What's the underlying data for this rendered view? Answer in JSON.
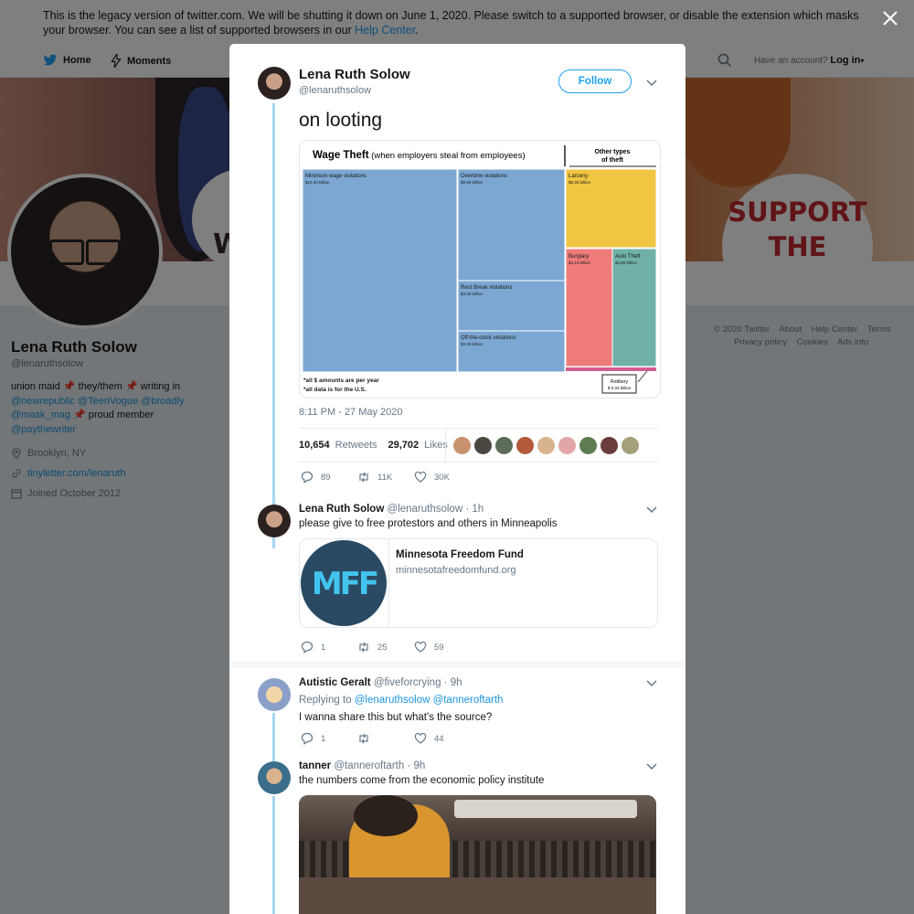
{
  "banner": {
    "text": "This is the legacy version of twitter.com. We will be shutting it down on June 1, 2020. Please switch to a supported browser, or disable the extension which masks your browser. You can see a list of supported browsers in our ",
    "link": "Help Center",
    "end": "."
  },
  "nav": {
    "home": "Home",
    "moments": "Moments",
    "have_account": "Have an account?",
    "login": "Log in"
  },
  "hero": {
    "sign_line1": "SUPPORT",
    "sign_line2": "THE UNION",
    "partial_letter": "W"
  },
  "profile": {
    "name": "Lena Ruth Solow",
    "handle": "@lenaruthsolow",
    "bio_1": "union maid ",
    "bio_2": " they/them ",
    "bio_3": " writing in",
    "bio_links_1": "@newrepublic @TeenVogue @broadly",
    "bio_link_2": "@mask_mag",
    "bio_4": " proud member",
    "bio_link_3": "@paythewriter",
    "location": "Brooklyn, NY",
    "website": "tinyletter.com/lenaruth",
    "joined": "Joined October 2012"
  },
  "footer": {
    "row1": [
      "© 2020 Twitter",
      "About",
      "Help Center",
      "Terms"
    ],
    "row2": [
      "Privacy policy",
      "Cookies",
      "Ads info"
    ]
  },
  "main_tweet": {
    "name": "Lena Ruth Solow",
    "handle": "@lenaruthsolow",
    "follow": "Follow",
    "text": "on looting",
    "timestamp": "8:11 PM - 27 May 2020",
    "retweets_count": "10,654",
    "retweets_label": "Retweets",
    "likes_count": "29,702",
    "likes_label": "Likes",
    "replies": "89",
    "retweets_short": "11K",
    "likes_short": "30K"
  },
  "chart_card": {
    "title_bold": "Wage Theft",
    "title_rest": " (when employers steal from employees)",
    "other_types": "Other types",
    "of_theft": "of theft",
    "cells": {
      "min_wage": {
        "label": "Minimum wage violations",
        "value": "$23.20 billion"
      },
      "overtime": {
        "label": "Overtime violations",
        "value": "$8.80 billion"
      },
      "rest": {
        "label": "Rest Break violations",
        "value": "$4.00 billion"
      },
      "offclock": {
        "label": "Off-the-clock violations",
        "value": "$3.20 billion"
      },
      "larceny": {
        "label": "Larceny",
        "value": "$5.30 billion"
      },
      "burglary": {
        "label": "Burglary",
        "value": "$4.10 billion"
      },
      "auto": {
        "label": "Auto Theft",
        "value": "$3.80 billion"
      },
      "robbery": {
        "label": "Robbery",
        "value": "$ 0.34 billion"
      }
    },
    "note1": "*all $ amounts are per year",
    "note2": "*all data is for the U.S.",
    "colors": {
      "wage": "#7ba7d2",
      "larceny": "#f0c542",
      "burglary": "#ef7b7b",
      "auto": "#6fb1a7",
      "robbery": "#d25c8f"
    }
  },
  "reply1": {
    "name": "Lena Ruth Solow",
    "meta": "@lenaruthsolow · 1h",
    "text": "please give to free protestors and others in Minneapolis",
    "card_title": "Minnesota Freedom Fund",
    "card_url": "minnesotafreedomfund.org",
    "card_logo": "MFF",
    "replies": "1",
    "retweets": "25",
    "likes": "59"
  },
  "reply2": {
    "name": "Autistic Geralt",
    "meta": "@fiveforcrying · 9h",
    "replying_prefix": "Replying to ",
    "replying_to": "@lenaruthsolow @tanneroftarth",
    "text": "I wanna share this but what's the source?",
    "replies": "1",
    "retweets": "",
    "likes": "44"
  },
  "reply3": {
    "name": "tanner",
    "meta": "@tanneroftarth · 9h",
    "text": "the numbers come from the economic policy institute"
  }
}
